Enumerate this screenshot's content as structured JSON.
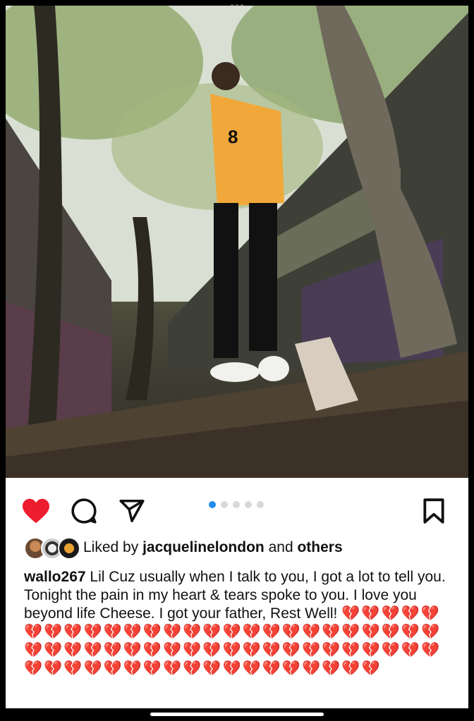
{
  "post": {
    "image_alt": "Person in yellow jersey standing on a dirt ledge beneath trees near graffiti-covered walls",
    "carousel_count": 5,
    "carousel_active_index": 0,
    "liked": true
  },
  "likes": {
    "prefix": "Liked by ",
    "user": "jacquelinelondon",
    "middle": " and ",
    "others": "others"
  },
  "caption": {
    "username": "wallo267",
    "text": " Lil Cuz usually when I talk to you, I got a lot to tell you. Tonight the pain in my heart & tears spoke to you. I love you beyond life Cheese. I got your father, Rest Well! ",
    "hearts": "💔💔💔💔💔💔💔💔💔💔💔💔💔💔💔💔💔💔💔💔💔💔💔💔💔💔💔💔💔💔💔💔💔💔💔💔💔💔💔💔💔💔💔💔💔💔💔💔💔💔💔💔💔💔💔💔💔💔💔💔💔💔💔💔💔"
  },
  "icons": {
    "like": "heart-icon",
    "comment": "comment-icon",
    "share": "send-icon",
    "save": "bookmark-icon"
  },
  "colors": {
    "like": "#ed1c2e",
    "carousel_active": "#1e8ef0",
    "carousel_inactive": "#d8d8d8"
  }
}
